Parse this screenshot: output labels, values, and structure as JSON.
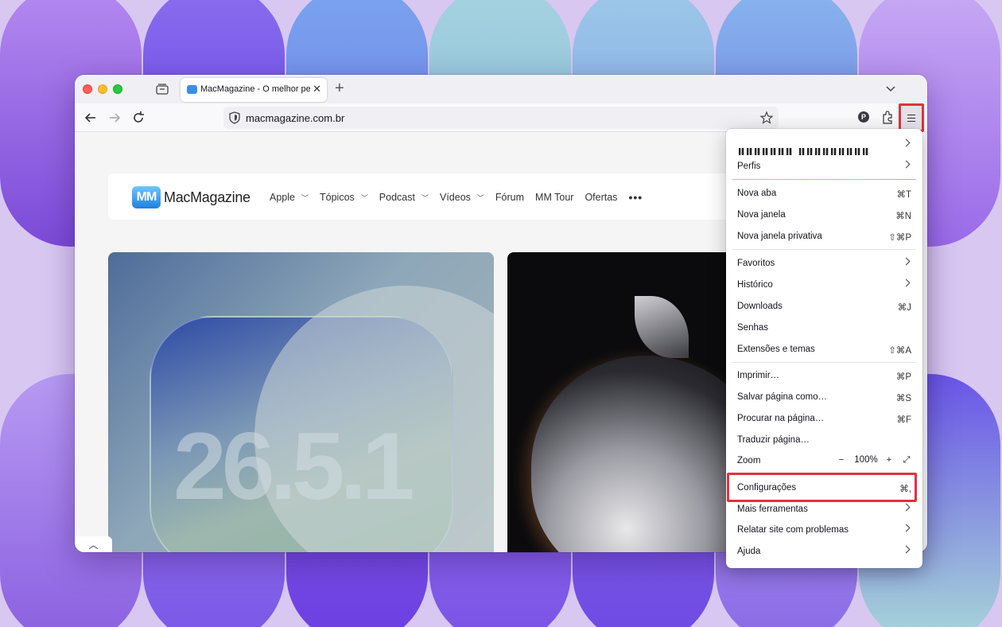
{
  "browser": {
    "tab_title": "MacMagazine - O melhor pedaço",
    "tab_close": "✕",
    "new_tab": "+",
    "url": "macmagazine.com.br",
    "profile_letter": "P"
  },
  "site": {
    "logo_badge": "MM",
    "logo_text": "MacMagazine",
    "nav": [
      {
        "label": "Apple",
        "has_dropdown": true
      },
      {
        "label": "Tópicos",
        "has_dropdown": true
      },
      {
        "label": "Podcast",
        "has_dropdown": true
      },
      {
        "label": "Vídeos",
        "has_dropdown": true
      },
      {
        "label": "Fórum",
        "has_dropdown": false
      },
      {
        "label": "MM Tour",
        "has_dropdown": false
      },
      {
        "label": "Ofertas",
        "has_dropdown": false
      }
    ],
    "more": "•••",
    "card1_text": "26.5.1",
    "scroll_up": "︿"
  },
  "menu": {
    "profile_label": "Perfis",
    "items": {
      "nova_aba": {
        "label": "Nova aba",
        "shortcut": "⌘T"
      },
      "nova_janela": {
        "label": "Nova janela",
        "shortcut": "⌘N"
      },
      "nova_privativa": {
        "label": "Nova janela privativa",
        "shortcut": "⇧⌘P"
      },
      "favoritos": {
        "label": "Favoritos"
      },
      "historico": {
        "label": "Histórico"
      },
      "downloads": {
        "label": "Downloads",
        "shortcut": "⌘J"
      },
      "senhas": {
        "label": "Senhas"
      },
      "extensoes": {
        "label": "Extensões e temas",
        "shortcut": "⇧⌘A"
      },
      "imprimir": {
        "label": "Imprimir…",
        "shortcut": "⌘P"
      },
      "salvar": {
        "label": "Salvar página como…",
        "shortcut": "⌘S"
      },
      "procurar": {
        "label": "Procurar na página…",
        "shortcut": "⌘F"
      },
      "traduzir": {
        "label": "Traduzir página…"
      },
      "zoom": {
        "label": "Zoom",
        "minus": "−",
        "value": "100%",
        "plus": "+",
        "fullscreen": "⤢"
      },
      "config": {
        "label": "Configurações",
        "shortcut": "⌘,"
      },
      "ferramentas": {
        "label": "Mais ferramentas"
      },
      "relatar": {
        "label": "Relatar site com problemas"
      },
      "ajuda": {
        "label": "Ajuda"
      }
    }
  },
  "colors": {
    "highlight": "#e0323e",
    "wallpaper": "#d8c7f1"
  }
}
